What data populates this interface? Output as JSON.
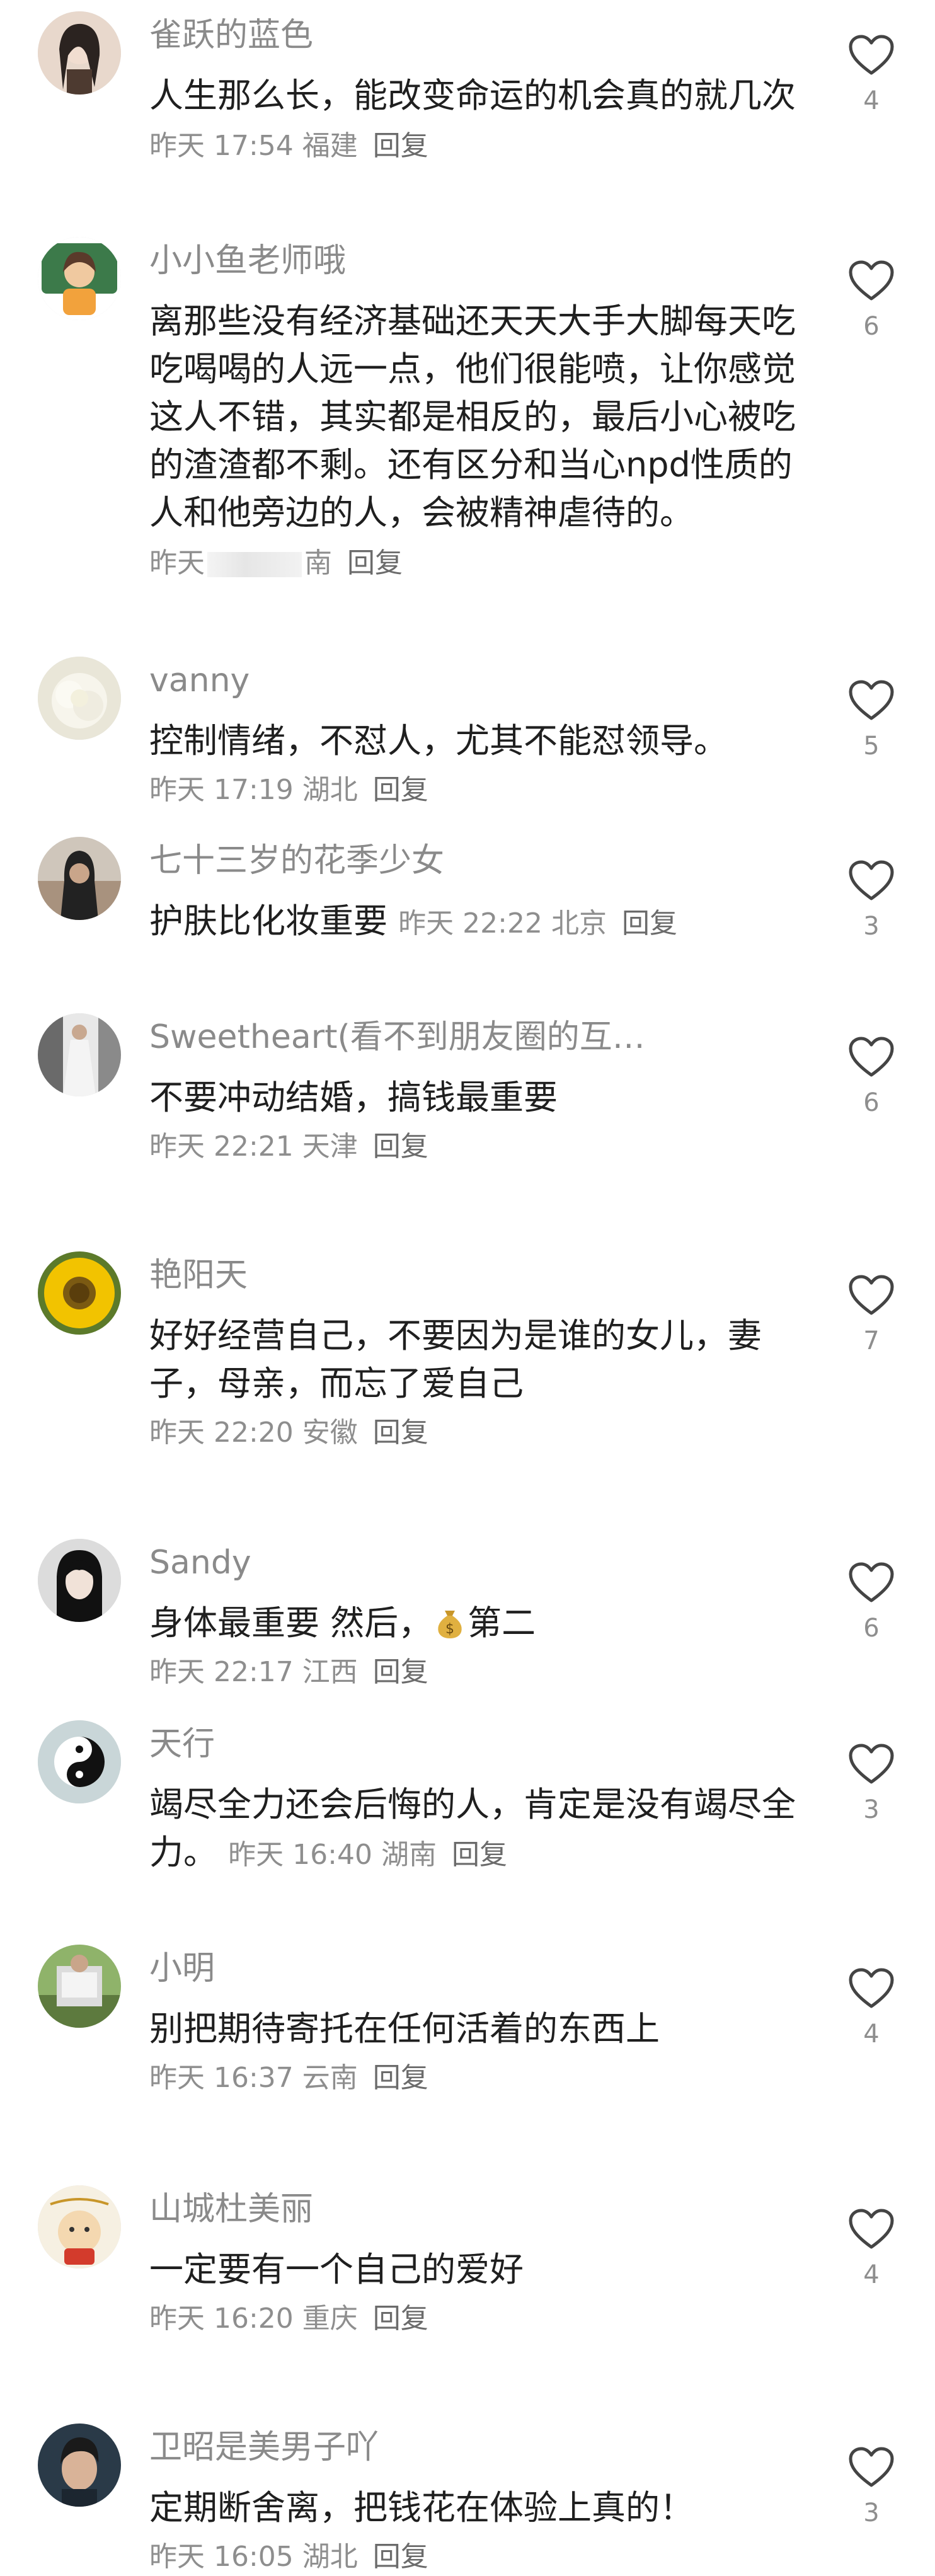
{
  "comments": [
    {
      "username": "雀跃的蓝色",
      "text": "人生那么长，能改变命运的机会真的就几次",
      "time": "昨天 17:54",
      "location": "福建",
      "reply": "回复",
      "likes": "4",
      "avatar_colors": [
        "#e8d8cc",
        "#2b2320"
      ]
    },
    {
      "username": "小小鱼老师哦",
      "text": "离那些没有经济基础还天天大手大脚每天吃吃喝喝的人远一点，他们很能喷，让你感觉这人不错，其实都是相反的，最后小心被吃的渣渣都不剩。还有区分和当心npd性质的人和他旁边的人，会被精神虐待的。",
      "time": "昨天",
      "location": "河南",
      "location_visible": "南",
      "reply": "回复",
      "likes": "6",
      "avatar_colors": [
        "#3c7a4a",
        "#f0c9a0"
      ]
    },
    {
      "username": "vanny",
      "text": "控制情绪，不怼人，尤其不能怼领导。",
      "time": "昨天 17:19",
      "location": "湖北",
      "reply": "回复",
      "likes": "5",
      "avatar_colors": [
        "#e9e6d8",
        "#f7f5ec"
      ]
    },
    {
      "username": "七十三岁的花季少女",
      "text": "护肤比化妆重要",
      "time": "昨天 22:22",
      "location": "北京",
      "reply": "回复",
      "likes": "3",
      "avatar_colors": [
        "#222222",
        "#c9a58a"
      ]
    },
    {
      "username": "Sweetheart(看不到朋友圈的互…",
      "text": "不要冲动结婚，搞钱最重要",
      "time": "昨天 22:21",
      "location": "天津",
      "reply": "回复",
      "likes": "6",
      "avatar_colors": [
        "#6a6a6a",
        "#e8e8e8"
      ]
    },
    {
      "username": "艳阳天",
      "text": "好好经营自己，不要因为是谁的女儿，妻子，母亲，而忘了爱自己",
      "time": "昨天 22:20",
      "location": "安徽",
      "reply": "回复",
      "likes": "7",
      "avatar_colors": [
        "#f2c300",
        "#7b5a12"
      ]
    },
    {
      "username": "Sandy",
      "text": "身体最重要  然后，",
      "text_suffix": "第二",
      "time": "昨天 22:17",
      "location": "江西",
      "reply": "回复",
      "likes": "6",
      "avatar_colors": [
        "#dcdcdc",
        "#111111"
      ]
    },
    {
      "username": "天行",
      "text": "竭尽全力还会后悔的人，肯定是没有竭尽全力。",
      "time": "昨天 16:40",
      "location": "湖南",
      "reply": "回复",
      "likes": "3",
      "avatar_colors": [
        "#c9d6d8",
        "#111111"
      ]
    },
    {
      "username": "小明",
      "text": "别把期待寄托在任何活着的东西上",
      "time": "昨天 16:37",
      "location": "云南",
      "reply": "回复",
      "likes": "4",
      "avatar_colors": [
        "#8fb36a",
        "#dcdcdc"
      ]
    },
    {
      "username": "山城杜美丽",
      "text": "一定要有一个自己的爱好",
      "time": "昨天 16:20",
      "location": "重庆",
      "reply": "回复",
      "likes": "4",
      "avatar_colors": [
        "#f6f0e2",
        "#d33b2c"
      ]
    },
    {
      "username": "卫昭是美男子吖",
      "text": "定期断舍离，把钱花在体验上真的！",
      "time": "昨天 16:05",
      "location": "湖北",
      "reply": "回复",
      "likes": "3",
      "avatar_colors": [
        "#2a3a48",
        "#d9b398"
      ]
    }
  ],
  "colors": {
    "username": "#8a8a8a",
    "text": "#1f1f1f",
    "meta": "#8e8e8e",
    "background": "#ffffff"
  },
  "icons": {
    "like": "heart-outline-icon",
    "money": "money-bag-icon"
  }
}
